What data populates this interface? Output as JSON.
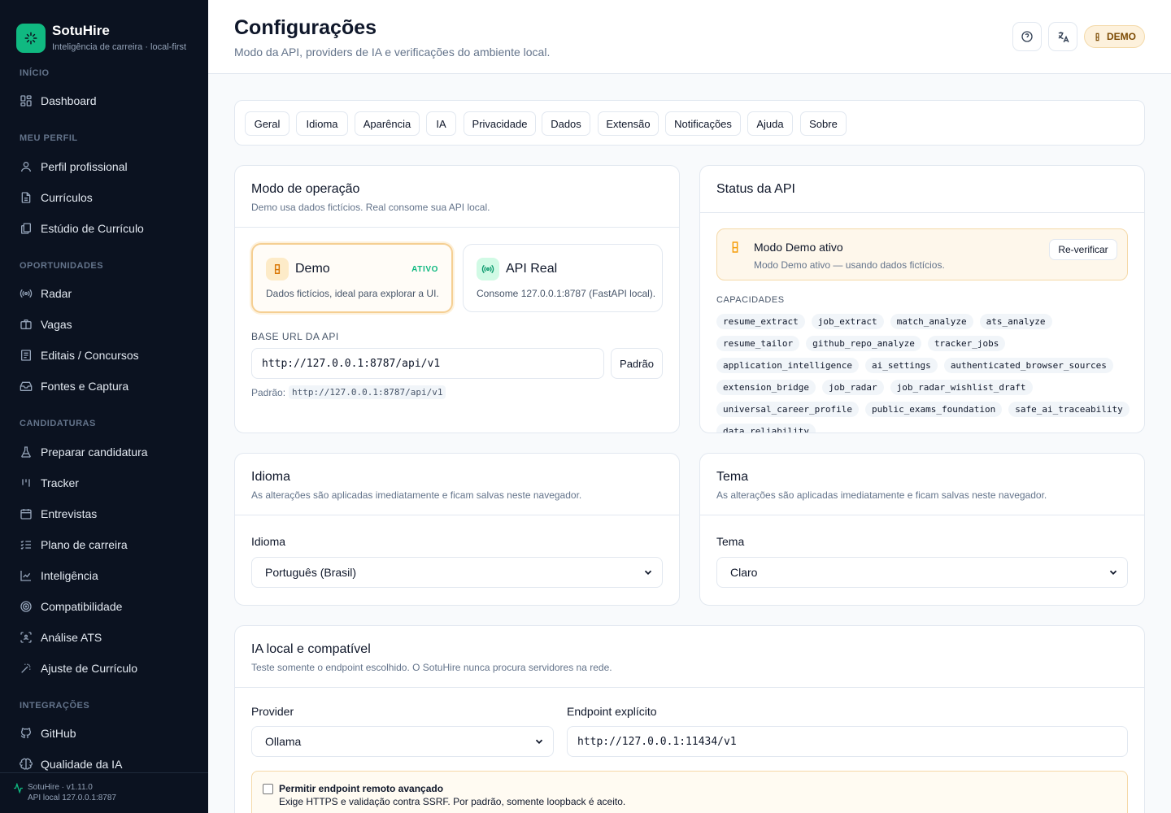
{
  "app": {
    "name": "SotuHire",
    "tagline": "Inteligência de carreira · local-first"
  },
  "sidebar": {
    "sections": [
      {
        "title": "INÍCIO",
        "items": [
          {
            "label": "Dashboard",
            "icon": "dashboard-icon"
          }
        ]
      },
      {
        "title": "MEU PERFIL",
        "items": [
          {
            "label": "Perfil profissional",
            "icon": "user-icon"
          },
          {
            "label": "Currículos",
            "icon": "file-icon"
          },
          {
            "label": "Estúdio de Currículo",
            "icon": "files-icon"
          }
        ]
      },
      {
        "title": "OPORTUNIDADES",
        "items": [
          {
            "label": "Radar",
            "icon": "radar-icon"
          },
          {
            "label": "Vagas",
            "icon": "briefcase-icon"
          },
          {
            "label": "Editais / Concursos",
            "icon": "document-list-icon"
          },
          {
            "label": "Fontes e Captura",
            "icon": "inbox-icon"
          }
        ]
      },
      {
        "title": "CANDIDATURAS",
        "items": [
          {
            "label": "Preparar candidatura",
            "icon": "flask-icon"
          },
          {
            "label": "Tracker",
            "icon": "kanban-icon"
          },
          {
            "label": "Entrevistas",
            "icon": "calendar-icon"
          },
          {
            "label": "Plano de carreira",
            "icon": "checklist-icon"
          },
          {
            "label": "Inteligência",
            "icon": "chart-line-icon"
          },
          {
            "label": "Compatibilidade",
            "icon": "target-icon"
          },
          {
            "label": "Análise ATS",
            "icon": "scan-icon"
          },
          {
            "label": "Ajuste de Currículo",
            "icon": "magic-wand-icon"
          }
        ]
      },
      {
        "title": "INTEGRAÇÕES",
        "items": [
          {
            "label": "GitHub",
            "icon": "github-icon"
          },
          {
            "label": "Qualidade da IA",
            "icon": "brain-icon"
          }
        ]
      }
    ],
    "footer": {
      "version": "SotuHire · v1.11.0",
      "api": "API local 127.0.0.1:8787"
    }
  },
  "header": {
    "title": "Configurações",
    "subtitle": "Modo da API, providers de IA e verificações do ambiente local.",
    "badge": "DEMO"
  },
  "tabs": [
    "Geral",
    "Idioma",
    "Aparência",
    "IA",
    "Privacidade",
    "Dados",
    "Extensão",
    "Notificações",
    "Ajuda",
    "Sobre"
  ],
  "mode_card": {
    "title": "Modo de operação",
    "subtitle": "Demo usa dados fictícios. Real consome sua API local.",
    "demo": {
      "name": "Demo",
      "status": "ATIVO",
      "desc": "Dados fictícios, ideal para explorar a UI."
    },
    "real": {
      "name": "API Real",
      "desc": "Consome 127.0.0.1:8787 (FastAPI local)."
    },
    "base_url_label": "BASE URL DA API",
    "base_url_value": "http://127.0.0.1:8787/api/v1",
    "default_button": "Padrão",
    "default_label": "Padrão:",
    "default_value": "http://127.0.0.1:8787/api/v1"
  },
  "status_card": {
    "title": "Status da API",
    "alert_title": "Modo Demo ativo",
    "alert_desc": "Modo Demo ativo — usando dados fictícios.",
    "recheck": "Re-verificar",
    "caps_label": "CAPACIDADES",
    "capabilities": [
      "resume_extract",
      "job_extract",
      "match_analyze",
      "ats_analyze",
      "resume_tailor",
      "github_repo_analyze",
      "tracker_jobs",
      "application_intelligence",
      "ai_settings",
      "authenticated_browser_sources",
      "extension_bridge",
      "job_radar",
      "job_radar_wishlist_draft",
      "universal_career_profile",
      "public_exams_foundation",
      "safe_ai_traceability",
      "data_reliability"
    ]
  },
  "language_card": {
    "title": "Idioma",
    "subtitle": "As alterações são aplicadas imediatamente e ficam salvas neste navegador.",
    "field_label": "Idioma",
    "selected": "Português (Brasil)"
  },
  "theme_card": {
    "title": "Tema",
    "subtitle": "As alterações são aplicadas imediatamente e ficam salvas neste navegador.",
    "field_label": "Tema",
    "selected": "Claro"
  },
  "ai_card": {
    "title": "IA local e compatível",
    "subtitle": "Teste somente o endpoint escolhido. O SotuHire nunca procura servidores na rede.",
    "provider_label": "Provider",
    "provider_selected": "Ollama",
    "endpoint_label": "Endpoint explícito",
    "endpoint_value": "http://127.0.0.1:11434/v1",
    "remote_title": "Permitir endpoint remoto avançado",
    "remote_desc": "Exige HTTPS e validação contra SSRF. Por padrão, somente loopback é aceito."
  },
  "colors": {
    "brand": "#10b981",
    "sidebar_bg": "#0b1220",
    "demo_accent": "#f59e0b"
  }
}
